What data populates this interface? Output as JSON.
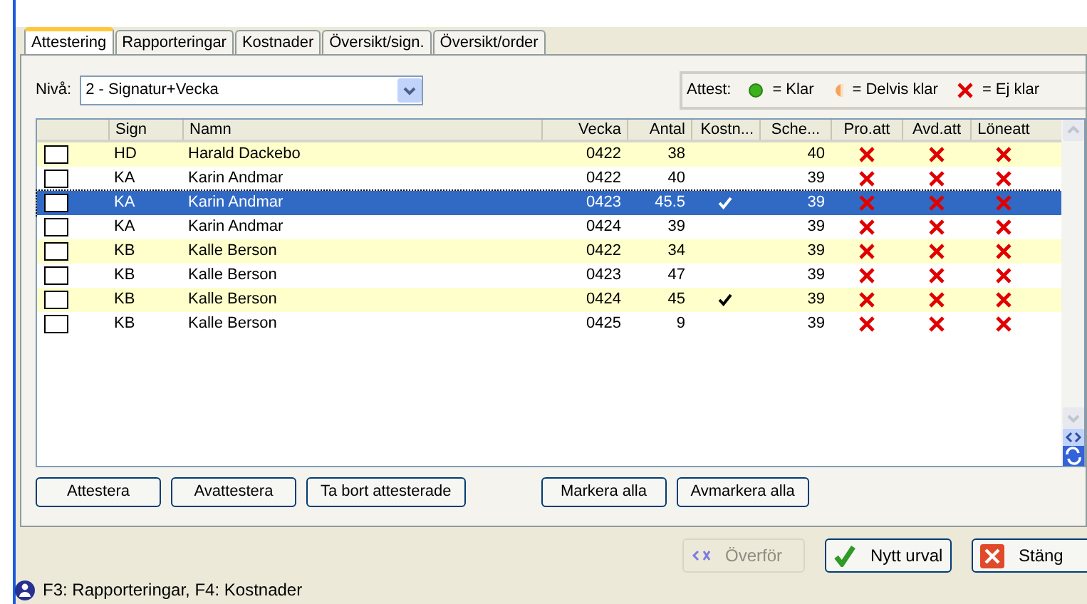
{
  "tabs": [
    {
      "label": "Attestering",
      "selected": true
    },
    {
      "label": "Rapporteringar",
      "selected": false
    },
    {
      "label": "Kostnader",
      "selected": false
    },
    {
      "label": "Översikt/sign.",
      "selected": false
    },
    {
      "label": "Översikt/order",
      "selected": false
    }
  ],
  "level": {
    "label": "Nivå:",
    "value": "2 - Signatur+Vecka"
  },
  "legend": {
    "label": "Attest:",
    "items": [
      {
        "kind": "klar",
        "text": "= Klar"
      },
      {
        "kind": "delvis",
        "text": "= Delvis klar"
      },
      {
        "kind": "ej",
        "text": "= Ej klar"
      }
    ]
  },
  "table": {
    "columns": [
      "Sign",
      "Namn",
      "Vecka",
      "Antal",
      "Kostn...",
      "Sche...",
      "Pro.att",
      "Avd.att",
      "Löneatt"
    ],
    "rows": [
      {
        "checked": false,
        "selected": false,
        "highlighted": true,
        "sign": "HD",
        "name": "Harald Dackebo",
        "week": "0422",
        "count": "38",
        "cost": false,
        "schedule": "40",
        "pro": false,
        "avd": false,
        "lone": false
      },
      {
        "checked": false,
        "selected": false,
        "highlighted": false,
        "sign": "KA",
        "name": "Karin Andmar",
        "week": "0422",
        "count": "40",
        "cost": false,
        "schedule": "39",
        "pro": false,
        "avd": false,
        "lone": false
      },
      {
        "checked": false,
        "selected": true,
        "sign": "KA",
        "name": "Karin Andmar",
        "week": "0423",
        "count": "45.5",
        "cost": true,
        "schedule": "39",
        "pro": false,
        "avd": false,
        "lone": false
      },
      {
        "checked": false,
        "selected": false,
        "highlighted": false,
        "sign": "KA",
        "name": "Karin Andmar",
        "week": "0424",
        "count": "39",
        "cost": false,
        "schedule": "39",
        "pro": false,
        "avd": false,
        "lone": false
      },
      {
        "checked": false,
        "selected": false,
        "highlighted": true,
        "sign": "KB",
        "name": "Kalle Berson",
        "week": "0422",
        "count": "34",
        "cost": false,
        "schedule": "39",
        "pro": false,
        "avd": false,
        "lone": false
      },
      {
        "checked": false,
        "selected": false,
        "highlighted": false,
        "sign": "KB",
        "name": "Kalle Berson",
        "week": "0423",
        "count": "47",
        "cost": false,
        "schedule": "39",
        "pro": false,
        "avd": false,
        "lone": false
      },
      {
        "checked": false,
        "selected": false,
        "highlighted": true,
        "sign": "KB",
        "name": "Kalle Berson",
        "week": "0424",
        "count": "45",
        "cost": true,
        "schedule": "39",
        "pro": false,
        "avd": false,
        "lone": false
      },
      {
        "checked": false,
        "selected": false,
        "highlighted": false,
        "sign": "KB",
        "name": "Kalle Berson",
        "week": "0425",
        "count": "9",
        "cost": false,
        "schedule": "39",
        "pro": false,
        "avd": false,
        "lone": false
      }
    ]
  },
  "actions": [
    "Attestera",
    "Avattestera",
    "Ta bort attesterade",
    "Markera alla",
    "Avmarkera alla"
  ],
  "footer_buttons": [
    {
      "kind": "transfer",
      "label": "Överför",
      "disabled": true
    },
    {
      "kind": "new",
      "label": "Nytt urval",
      "disabled": false
    },
    {
      "kind": "close",
      "label": "Stäng",
      "disabled": false
    }
  ],
  "status_bar": "F3: Rapporteringar, F4: Kostnader"
}
